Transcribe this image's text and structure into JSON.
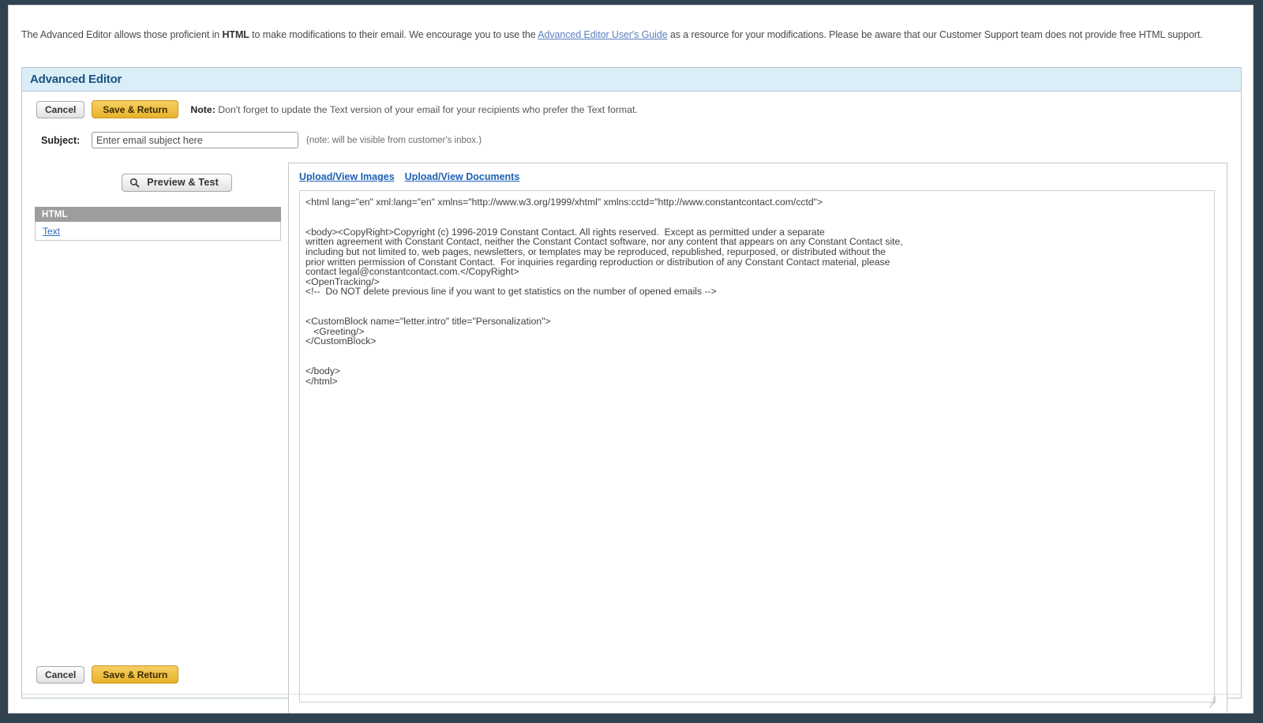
{
  "intro": {
    "part1": "The Advanced Editor allows those proficient in ",
    "strong1": "HTML",
    "part2": " to make modifications to their email. We encourage you to use the ",
    "link_text": "Advanced Editor User's Guide",
    "part3": " as a resource for your modifications. Please be aware that our Customer Support team does not provide free HTML support."
  },
  "panel": {
    "title": "Advanced Editor"
  },
  "toolbar": {
    "cancel_label": "Cancel",
    "save_label": "Save & Return",
    "note_prefix": "Note:",
    "note_body": " Don't forget to update the Text version of your email for your recipients who prefer the Text format."
  },
  "subject": {
    "label": "Subject:",
    "value": "Enter email subject here",
    "placeholder": "Enter email subject here",
    "note": "(note: will be visible from customer's inbox.)"
  },
  "left": {
    "preview_label": "Preview & Test",
    "preview_icon": "magnifier-icon",
    "tab_html_label": "HTML",
    "tab_text_label": "Text"
  },
  "right": {
    "upload_images_label": "Upload/View Images",
    "upload_documents_label": "Upload/View Documents",
    "code": "<html lang=\"en\" xml:lang=\"en\" xmlns=\"http://www.w3.org/1999/xhtml\" xmlns:cctd=\"http://www.constantcontact.com/cctd\">\n\n\n<body><CopyRight>Copyright (c) 1996-2019 Constant Contact. All rights reserved.  Except as permitted under a separate\nwritten agreement with Constant Contact, neither the Constant Contact software, nor any content that appears on any Constant Contact site,\nincluding but not limited to, web pages, newsletters, or templates may be reproduced, republished, repurposed, or distributed without the\nprior written permission of Constant Contact.  For inquiries regarding reproduction or distribution of any Constant Contact material, please\ncontact legal@constantcontact.com.</CopyRight>\n<OpenTracking/>\n<!--  Do NOT delete previous line if you want to get statistics on the number of opened emails -->\n\n\n<CustomBlock name=\"letter.intro\" title=\"Personalization\">\n   <Greeting/>\n</CustomBlock>\n\n\n</body>\n</html>"
  },
  "bottom": {
    "cancel_label": "Cancel",
    "save_label": "Save & Return"
  },
  "colors": {
    "page_background": "#31424f",
    "panel_header_bg": "#d9eef7",
    "panel_header_text": "#1c4f82",
    "gold_button": "#e8b32c",
    "tab_active_bg": "#9e9e9e",
    "link": "#1d60b5"
  }
}
